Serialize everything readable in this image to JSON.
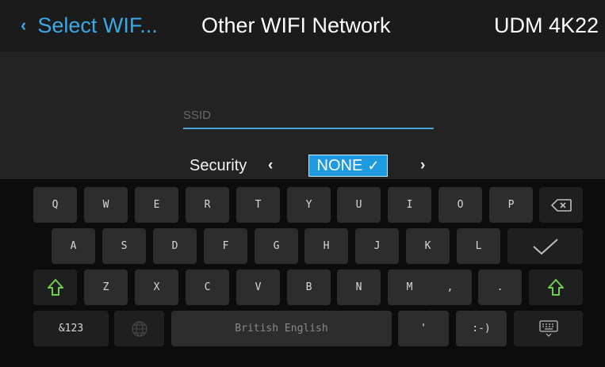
{
  "header": {
    "back_label": "Select WIF...",
    "title": "Other WIFI Network",
    "device": "UDM 4K22"
  },
  "form": {
    "ssid_placeholder": "SSID",
    "ssid_value": "",
    "security_label": "Security",
    "security_value": "NONE"
  },
  "keyboard": {
    "row1": [
      "Q",
      "W",
      "E",
      "R",
      "T",
      "Y",
      "U",
      "I",
      "O",
      "P"
    ],
    "row2": [
      "A",
      "S",
      "D",
      "F",
      "G",
      "H",
      "J",
      "K",
      "L"
    ],
    "row3": [
      "Z",
      "X",
      "C",
      "V",
      "B",
      "N",
      "M",
      ",",
      "."
    ],
    "symbols_label": "&123",
    "space_label": "British English",
    "apostrophe_label": "'",
    "smiley_label": ":-)"
  },
  "colors": {
    "accent": "#3aa9e8",
    "selection": "#1e9be0",
    "shift_green": "#6fcf4b"
  },
  "icons": {
    "back": "chevron-left-icon",
    "check": "check-icon",
    "backspace": "backspace-icon",
    "enter": "checkmark-icon",
    "shift": "shift-arrow-icon",
    "language": "globe-icon",
    "hide_keyboard": "keyboard-icon"
  }
}
